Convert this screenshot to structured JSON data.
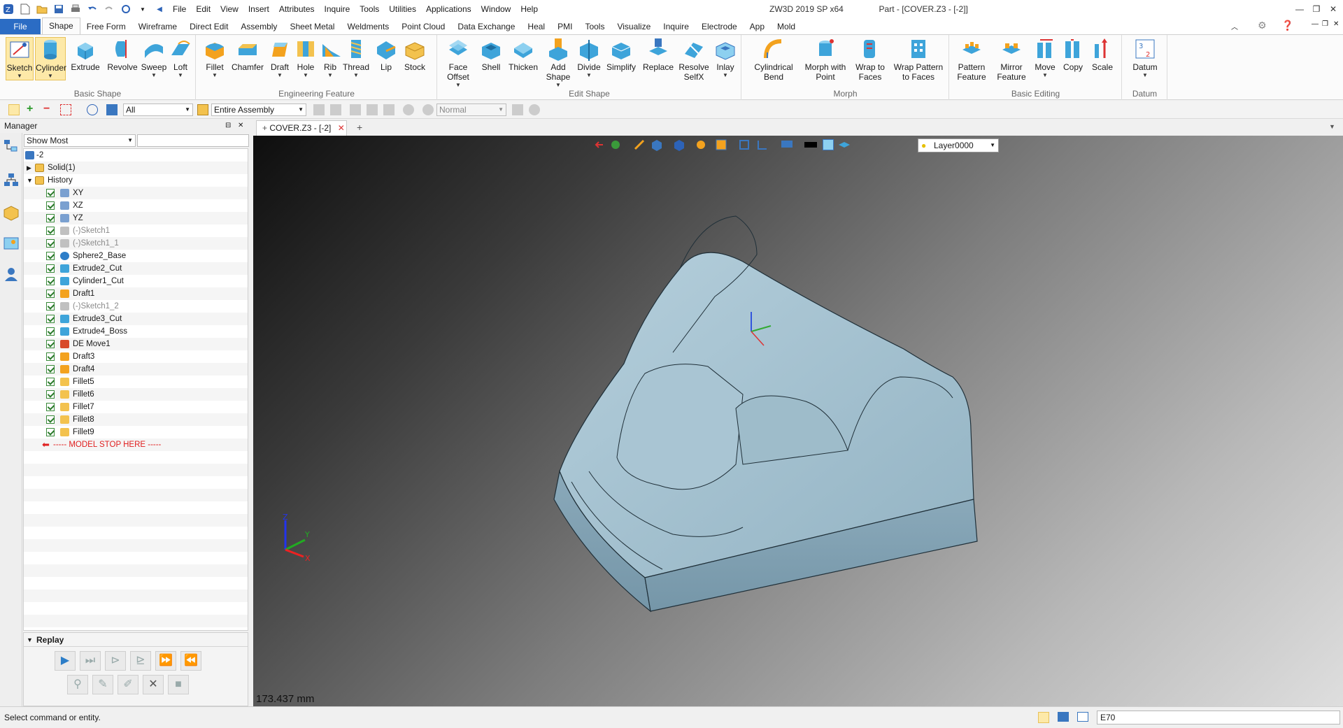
{
  "titlebar": {
    "app_title": "ZW3D 2019 SP x64",
    "doc_title": "Part - [COVER.Z3 - [-2]]",
    "menus": [
      "File",
      "Edit",
      "View",
      "Insert",
      "Attributes",
      "Inquire",
      "Tools",
      "Utilities",
      "Applications",
      "Window",
      "Help"
    ]
  },
  "ribbon_tabs": [
    "File",
    "Shape",
    "Free Form",
    "Wireframe",
    "Direct Edit",
    "Assembly",
    "Sheet Metal",
    "Weldments",
    "Point Cloud",
    "Data Exchange",
    "Heal",
    "PMI",
    "Tools",
    "Visualize",
    "Inquire",
    "Electrode",
    "App",
    "Mold"
  ],
  "active_tab": "Shape",
  "ribbon": {
    "groups": [
      {
        "label": "Basic Shape",
        "buttons": [
          "Sketch",
          "Cylinder",
          "Extrude",
          "Revolve",
          "Sweep",
          "Loft"
        ]
      },
      {
        "label": "Engineering Feature",
        "buttons": [
          "Fillet",
          "Chamfer",
          "Draft",
          "Hole",
          "Rib",
          "Thread",
          "Lip",
          "Stock"
        ]
      },
      {
        "label": "Edit Shape",
        "buttons": [
          "Face Offset",
          "Shell",
          "Thicken",
          "Add Shape",
          "Divide",
          "Simplify",
          "Replace",
          "Resolve SelfX",
          "Inlay"
        ]
      },
      {
        "label": "Morph",
        "buttons": [
          "Cylindrical Bend",
          "Morph with Point",
          "Wrap to Faces",
          "Wrap Pattern to Faces"
        ]
      },
      {
        "label": "Basic Editing",
        "buttons": [
          "Pattern Feature",
          "Mirror Feature",
          "Move",
          "Copy",
          "Scale"
        ]
      },
      {
        "label": "Datum",
        "buttons": [
          "Datum"
        ]
      }
    ]
  },
  "toolbar2": {
    "filter_value": "All",
    "assembly_value": "Entire Assembly",
    "style_value": "Normal"
  },
  "manager": {
    "title": "Manager",
    "show_most": "Show Most",
    "tree": [
      {
        "label": "-2",
        "type": "root"
      },
      {
        "label": "Solid(1)",
        "type": "folder"
      },
      {
        "label": "History",
        "type": "folder"
      },
      {
        "label": "XY",
        "type": "plane"
      },
      {
        "label": "XZ",
        "type": "plane"
      },
      {
        "label": "YZ",
        "type": "plane"
      },
      {
        "label": "(-)Sketch1",
        "type": "sketch"
      },
      {
        "label": "(-)Sketch1_1",
        "type": "sketch"
      },
      {
        "label": "Sphere2_Base",
        "type": "sphere"
      },
      {
        "label": "Extrude2_Cut",
        "type": "feature"
      },
      {
        "label": "Cylinder1_Cut",
        "type": "cylinder"
      },
      {
        "label": "Draft1",
        "type": "draft"
      },
      {
        "label": "(-)Sketch1_2",
        "type": "sketch"
      },
      {
        "label": "Extrude3_Cut",
        "type": "feature"
      },
      {
        "label": "Extrude4_Boss",
        "type": "feature"
      },
      {
        "label": "DE Move1",
        "type": "move"
      },
      {
        "label": "Draft3",
        "type": "draft"
      },
      {
        "label": "Draft4",
        "type": "draft"
      },
      {
        "label": "Fillet5",
        "type": "fillet"
      },
      {
        "label": "Fillet6",
        "type": "fillet"
      },
      {
        "label": "Fillet7",
        "type": "fillet"
      },
      {
        "label": "Fillet8",
        "type": "fillet"
      },
      {
        "label": "Fillet9",
        "type": "fillet"
      },
      {
        "label": "----- MODEL STOP HERE -----",
        "type": "stop"
      }
    ],
    "replay_label": "Replay"
  },
  "document": {
    "tab_label": "COVER.Z3 - [-2]",
    "layer": "Layer0000",
    "measure": "173.437 mm",
    "axis_x": "X",
    "axis_y": "Y",
    "axis_z": "Z"
  },
  "status": {
    "message": "Select command or entity.",
    "input_value": "E70"
  },
  "colors": {
    "model": "#9fbccb",
    "file_tab": "#2b6cc4",
    "stop_marker": "#e02020"
  }
}
